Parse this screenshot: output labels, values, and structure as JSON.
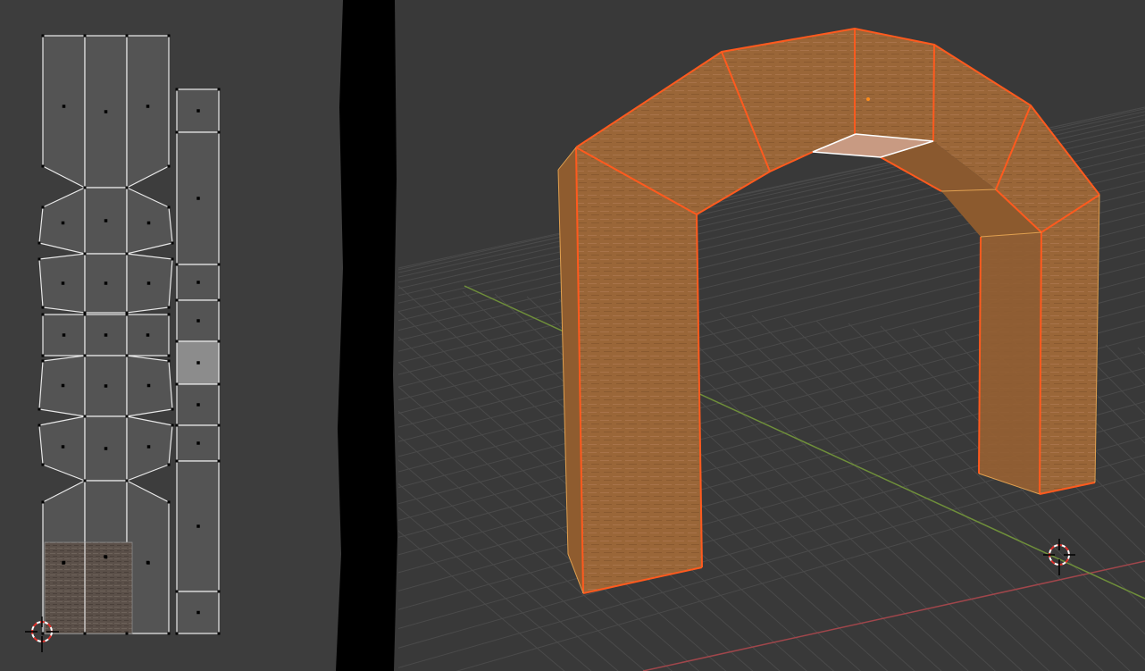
{
  "app": "blender",
  "uv_editor": {
    "background": "#3d3d3d",
    "face_fill": "#545454",
    "selected_face_fill": "#8c8c8c",
    "edge_color": "#e8e8e8",
    "texture_preview": "wood-texture"
  },
  "viewport": {
    "background": "#393939",
    "grid_color": "#4a4a4a",
    "x_axis_color": "#a0464b",
    "y_axis_color": "#6f8f3a",
    "object": "arch-mesh",
    "selected_edge_color": "#ff5a1e",
    "face_color": "#9c6737"
  },
  "icons": [
    "uv-cursor-icon",
    "3d-cursor-icon"
  ]
}
